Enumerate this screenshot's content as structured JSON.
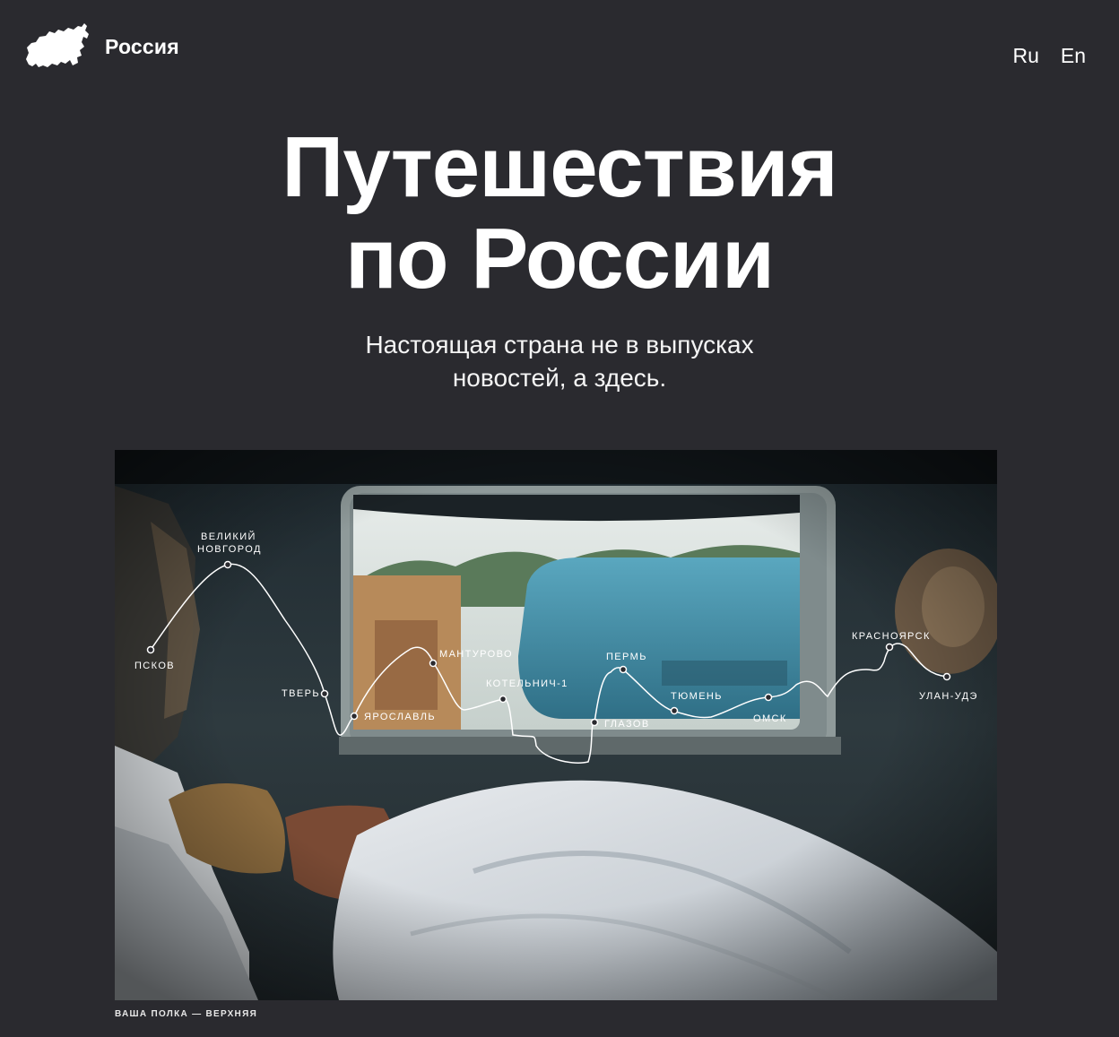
{
  "header": {
    "logo_text": "Россия",
    "logo_icon": "russia-map-icon",
    "languages": [
      "Ru",
      "En"
    ]
  },
  "hero": {
    "title_line1": "Путешествия",
    "title_line2": "по России",
    "subtitle_line1": "Настоящая страна не в выпусках",
    "subtitle_line2": "новостей, а здесь."
  },
  "photo": {
    "caption": "ВАША ПОЛКА — ВЕРХНЯЯ",
    "route": {
      "cities": [
        {
          "name": "ПСКОВ"
        },
        {
          "name": "ВЕЛИКИЙ",
          "name2": "НОВГОРОД"
        },
        {
          "name": "ТВЕРЬ"
        },
        {
          "name": "ЯРОСЛАВЛЬ"
        },
        {
          "name": "МАНТУРОВО"
        },
        {
          "name": "КОТЕЛЬНИЧ-1"
        },
        {
          "name": "ГЛАЗОВ"
        },
        {
          "name": "ПЕРМЬ"
        },
        {
          "name": "ТЮМЕНЬ"
        },
        {
          "name": "ОМСК"
        },
        {
          "name": "КРАСНОЯРСК"
        },
        {
          "name": "УЛАН-УДЭ"
        }
      ]
    }
  }
}
